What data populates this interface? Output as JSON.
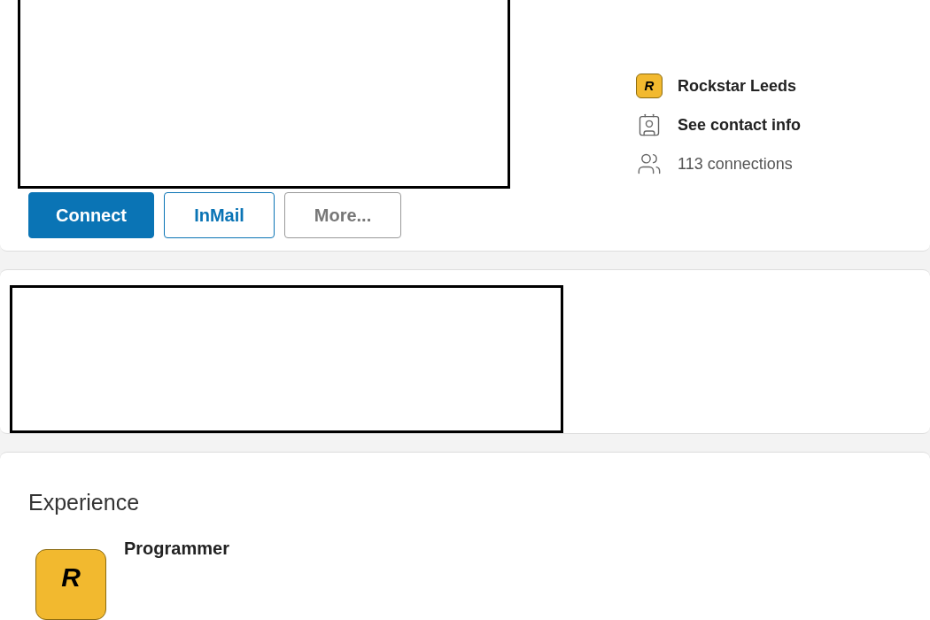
{
  "profile_card": {
    "buttons": [
      {
        "kind": "primary",
        "label": "Connect"
      },
      {
        "kind": "outline",
        "label": "InMail"
      },
      {
        "kind": "secondary",
        "label": "More..."
      }
    ],
    "info": [
      {
        "kind": "company",
        "logo_text": "R",
        "label": "Rockstar Leeds"
      },
      {
        "kind": "contact",
        "label": "See contact info"
      },
      {
        "kind": "connections",
        "label": "113 connections"
      }
    ]
  },
  "experience": {
    "title": "Experience",
    "items": [
      {
        "logo_text": "R",
        "role": "Programmer"
      }
    ]
  }
}
